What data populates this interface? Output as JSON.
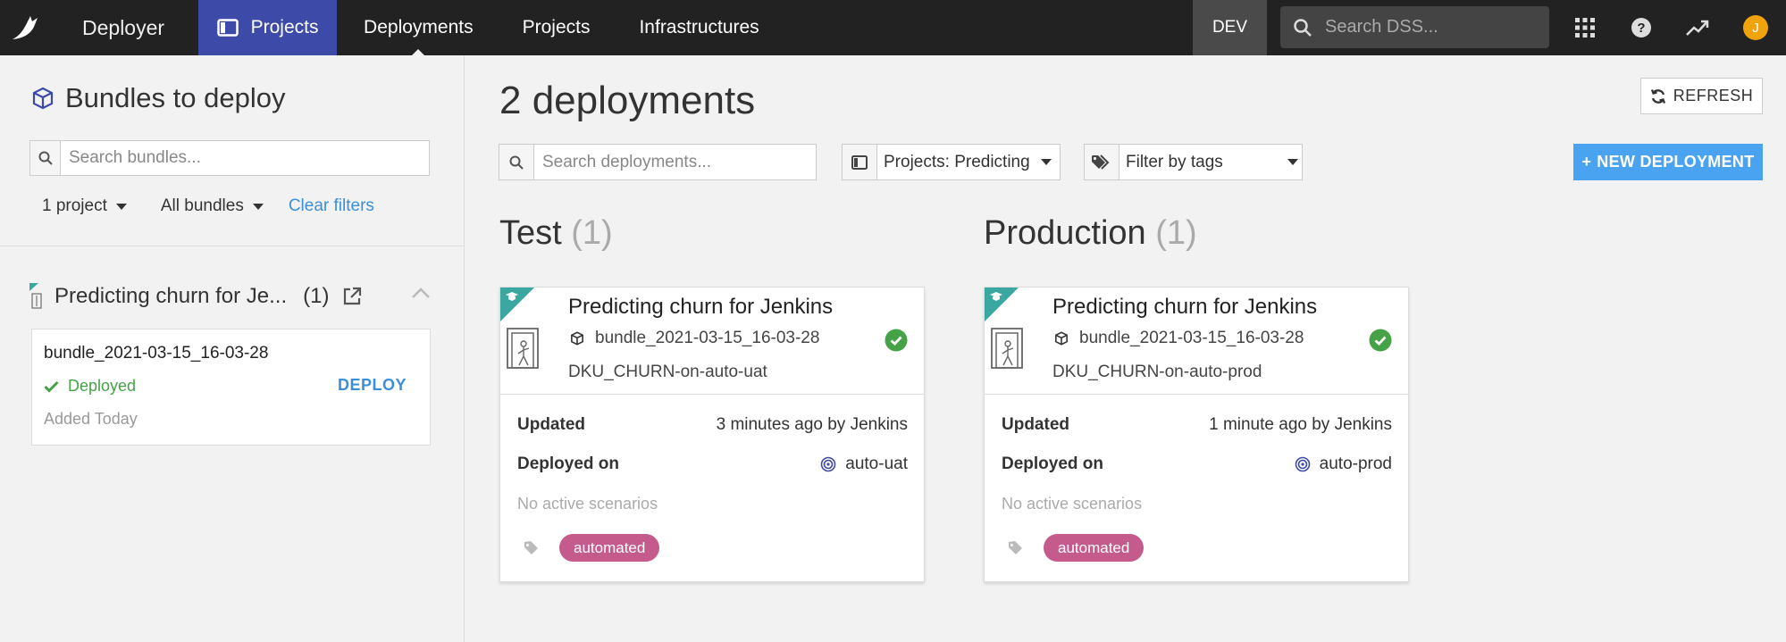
{
  "topnav": {
    "app_name": "Deployer",
    "active_tab": "Projects",
    "links": [
      "Deployments",
      "Projects",
      "Infrastructures"
    ],
    "env": "DEV",
    "search_placeholder": "Search DSS...",
    "avatar_initial": "J",
    "colors": {
      "bar": "#222222",
      "active": "#3d4aa8",
      "avatar": "#f0a30a"
    }
  },
  "left": {
    "title": "Bundles to deploy",
    "search_placeholder": "Search bundles...",
    "filter_project": "1 project",
    "filter_bundles": "All bundles",
    "clear_filters": "Clear filters",
    "project": {
      "name": "Predicting churn for Je...",
      "count": "(1)"
    },
    "bundle": {
      "name": "bundle_2021-03-15_16-03-28",
      "status": "Deployed",
      "deploy_label": "DEPLOY",
      "added": "Added Today"
    }
  },
  "main": {
    "title": "2 deployments",
    "refresh_label": "REFRESH",
    "search_placeholder": "Search deployments...",
    "projects_filter": "Projects: Predicting",
    "tags_filter": "Filter by tags",
    "new_deployment_label": "NEW DEPLOYMENT",
    "columns": [
      {
        "name": "Test",
        "count": "(1)",
        "card": {
          "title": "Predicting churn for Jenkins",
          "bundle": "bundle_2021-03-15_16-03-28",
          "deployment_id": "DKU_CHURN-on-auto-uat",
          "updated_label": "Updated",
          "updated_value": "3 minutes ago by Jenkins",
          "deployed_on_label": "Deployed on",
          "deployed_on_value": "auto-uat",
          "scenarios": "No active scenarios",
          "tag": "automated"
        }
      },
      {
        "name": "Production",
        "count": "(1)",
        "card": {
          "title": "Predicting churn for Jenkins",
          "bundle": "bundle_2021-03-15_16-03-28",
          "deployment_id": "DKU_CHURN-on-auto-prod",
          "updated_label": "Updated",
          "updated_value": "1 minute ago by Jenkins",
          "deployed_on_label": "Deployed on",
          "deployed_on_value": "auto-prod",
          "scenarios": "No active scenarios",
          "tag": "automated"
        }
      }
    ],
    "colors": {
      "accent": "#4aa3f0",
      "tag": "#c45b8c",
      "ok": "#46a246",
      "corner": "#3aa7a1"
    }
  }
}
